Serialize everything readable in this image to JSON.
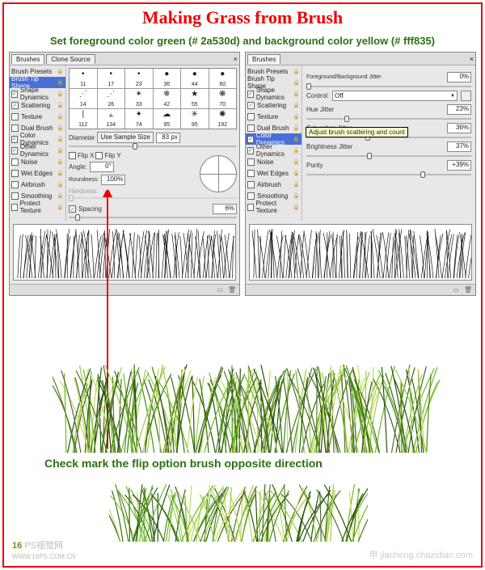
{
  "title": "Making Grass from Brush",
  "subtitle": "Set foreground color green (# 2a530d) and background color yellow (# fff835)",
  "annotation": "Check mark the flip option brush opposite direction",
  "watermark_left_logo": "16",
  "watermark_left_text": "PS视觉网",
  "watermark_left_url": "WWW.16PS.COM.CN",
  "watermark_right": "甲 jiacheng.chazidian.com",
  "panelA": {
    "tabs": {
      "brushes": "Brushes",
      "clone": "Clone Source",
      "close": "×"
    },
    "sidebar": [
      {
        "label": "Brush Presets",
        "checked": null
      },
      {
        "label": "Brush Tip Shape",
        "checked": null,
        "selected": true
      },
      {
        "label": "Shape Dynamics",
        "checked": true
      },
      {
        "label": "Scattering",
        "checked": true
      },
      {
        "label": "Texture",
        "checked": false
      },
      {
        "label": "Dual Brush",
        "checked": false
      },
      {
        "label": "Color Dynamics",
        "checked": true
      },
      {
        "label": "Other Dynamics",
        "checked": true
      },
      {
        "label": "Noise",
        "checked": false
      },
      {
        "label": "Wet Edges",
        "checked": false
      },
      {
        "label": "Airbrush",
        "checked": false
      },
      {
        "label": "Smoothing",
        "checked": false
      },
      {
        "label": "Protect Texture",
        "checked": false
      }
    ],
    "thumbs": [
      {
        "n": "11"
      },
      {
        "n": "17"
      },
      {
        "n": "23"
      },
      {
        "n": "36"
      },
      {
        "n": "44"
      },
      {
        "n": "60"
      },
      {
        "n": "14"
      },
      {
        "n": "26"
      },
      {
        "n": "33"
      },
      {
        "n": "42"
      },
      {
        "n": "55"
      },
      {
        "n": "70"
      },
      {
        "n": "112"
      },
      {
        "n": "134"
      },
      {
        "n": "74"
      },
      {
        "n": "95"
      },
      {
        "n": "95"
      },
      {
        "n": "192"
      }
    ],
    "diameter_label": "Diameter",
    "use_sample": "Use Sample Size",
    "diameter_value": "83 px",
    "flipx_label": "Flip X",
    "flipy_label": "Flip Y",
    "angle_label": "Angle:",
    "angle_value": "0°",
    "roundness_label": "Roundness:",
    "roundness_value": "100%",
    "hardness_label": "Hardness:",
    "spacing_label": "Spacing",
    "spacing_value": "6%"
  },
  "panelB": {
    "tabs": {
      "brushes": "Brushes",
      "close": "×"
    },
    "sidebar": [
      {
        "label": "Brush Presets",
        "checked": null
      },
      {
        "label": "Brush Tip Shape",
        "checked": null
      },
      {
        "label": "Shape Dynamics",
        "checked": true
      },
      {
        "label": "Scattering",
        "checked": true
      },
      {
        "label": "Texture",
        "checked": false
      },
      {
        "label": "Dual Brush",
        "checked": false
      },
      {
        "label": "Color Dynamics",
        "checked": true,
        "selected": true
      },
      {
        "label": "Other Dynamics",
        "checked": true
      },
      {
        "label": "Noise",
        "checked": false
      },
      {
        "label": "Wet Edges",
        "checked": false
      },
      {
        "label": "Airbrush",
        "checked": false
      },
      {
        "label": "Smoothing",
        "checked": false
      },
      {
        "label": "Protect Texture",
        "checked": false
      }
    ],
    "fgbg_label": "Foreground/Background Jitter",
    "fgbg_value": "0%",
    "control_label": "Control:",
    "control_value": "Off",
    "hue_label": "Hue Jitter",
    "hue_value": "23%",
    "sat_label": "Saturation Jitter",
    "sat_value": "36%",
    "bri_label": "Brightness Jitter",
    "bri_value": "37%",
    "pur_label": "Purity",
    "pur_value": "+39%",
    "tooltip": "Adjust brush scattering and count"
  },
  "icons": {
    "lock": "🔒",
    "trash": "🗑",
    "doc": "▭",
    "menu": "▾"
  }
}
